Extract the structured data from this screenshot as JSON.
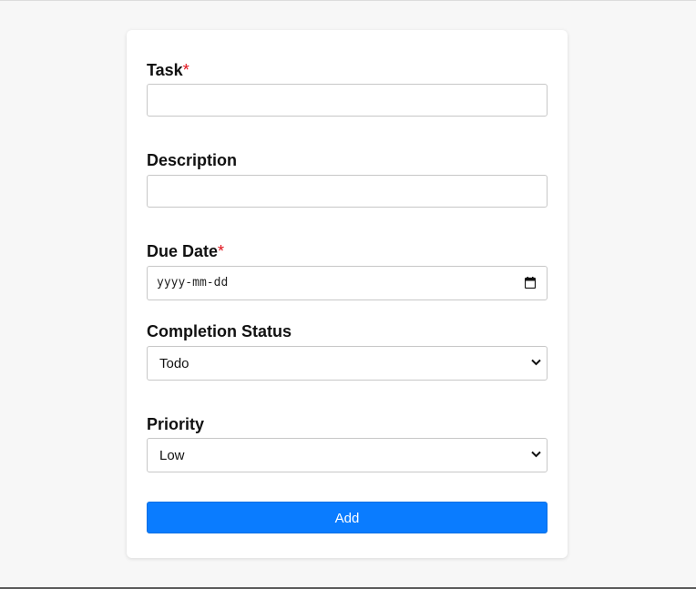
{
  "form": {
    "task": {
      "label": "Task",
      "required_mark": "*",
      "value": ""
    },
    "description": {
      "label": "Description",
      "value": ""
    },
    "due_date": {
      "label": "Due Date",
      "required_mark": "*",
      "placeholder": "yyyy-mm-dd"
    },
    "completion_status": {
      "label": "Completion Status",
      "selected": "Todo"
    },
    "priority": {
      "label": "Priority",
      "selected": "Low"
    },
    "submit_label": "Add"
  },
  "colors": {
    "accent": "#0a7cff",
    "required": "#e0101a",
    "background": "#f7f7f7",
    "card": "#ffffff"
  },
  "icons": {
    "date": "calendar-icon",
    "select": "chevron-down-icon"
  }
}
